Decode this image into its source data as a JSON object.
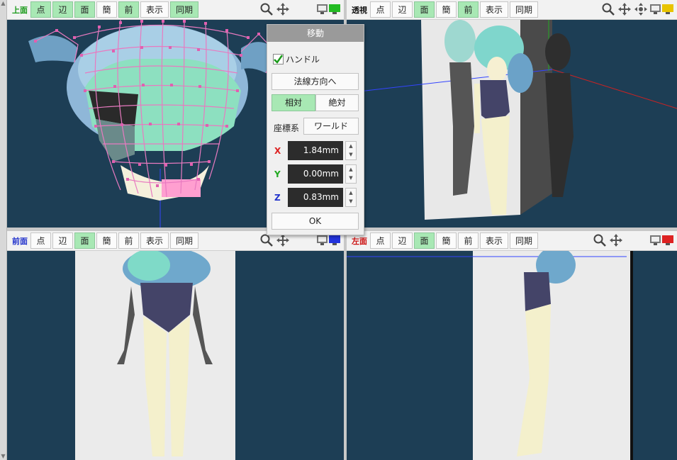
{
  "viewports": {
    "top": {
      "title": "上面",
      "title_color": "#1a9a1a",
      "buttons": [
        {
          "label": "点",
          "active": true
        },
        {
          "label": "辺",
          "active": true
        },
        {
          "label": "面",
          "active": true
        },
        {
          "label": "簡",
          "active": false
        },
        {
          "label": "前",
          "active": true
        },
        {
          "label": "表示",
          "active": false
        },
        {
          "label": "同期",
          "active": true
        }
      ],
      "monitor_color": "#22bb22"
    },
    "perspective": {
      "title": "透視",
      "title_color": "#111111",
      "buttons": [
        {
          "label": "点",
          "active": false
        },
        {
          "label": "辺",
          "active": false
        },
        {
          "label": "面",
          "active": true
        },
        {
          "label": "簡",
          "active": false
        },
        {
          "label": "前",
          "active": true
        },
        {
          "label": "表示",
          "active": false
        },
        {
          "label": "同期",
          "active": false
        }
      ],
      "monitor_color": "#e8c400"
    },
    "front": {
      "title": "前面",
      "title_color": "#2233cc",
      "buttons": [
        {
          "label": "点",
          "active": false
        },
        {
          "label": "辺",
          "active": false
        },
        {
          "label": "面",
          "active": true
        },
        {
          "label": "簡",
          "active": false
        },
        {
          "label": "前",
          "active": false
        },
        {
          "label": "表示",
          "active": false
        },
        {
          "label": "同期",
          "active": false
        }
      ],
      "monitor_color": "#2233dd"
    },
    "left": {
      "title": "左面",
      "title_color": "#cc1111",
      "buttons": [
        {
          "label": "点",
          "active": false
        },
        {
          "label": "辺",
          "active": false
        },
        {
          "label": "面",
          "active": true
        },
        {
          "label": "簡",
          "active": false
        },
        {
          "label": "前",
          "active": false
        },
        {
          "label": "表示",
          "active": false
        },
        {
          "label": "同期",
          "active": false
        }
      ],
      "monitor_color": "#dd2222"
    }
  },
  "move_dialog": {
    "title": "移動",
    "handle_label": "ハンドル",
    "handle_checked": true,
    "normal_button": "法線方向へ",
    "relative_label": "相対",
    "absolute_label": "絶対",
    "mode_active": "relative",
    "coord_label": "座標系",
    "coord_value": "ワールド",
    "x_label": "X",
    "x_value": "1.84mm",
    "y_label": "Y",
    "y_value": "0.00mm",
    "z_label": "Z",
    "z_value": "0.83mm",
    "ok_label": "OK",
    "axis_colors": {
      "x": "#dd2222",
      "y": "#22aa22",
      "z": "#2233cc"
    }
  },
  "icons": [
    "zoom-icon",
    "pan-icon",
    "rotate-icon",
    "monitor-icon"
  ]
}
